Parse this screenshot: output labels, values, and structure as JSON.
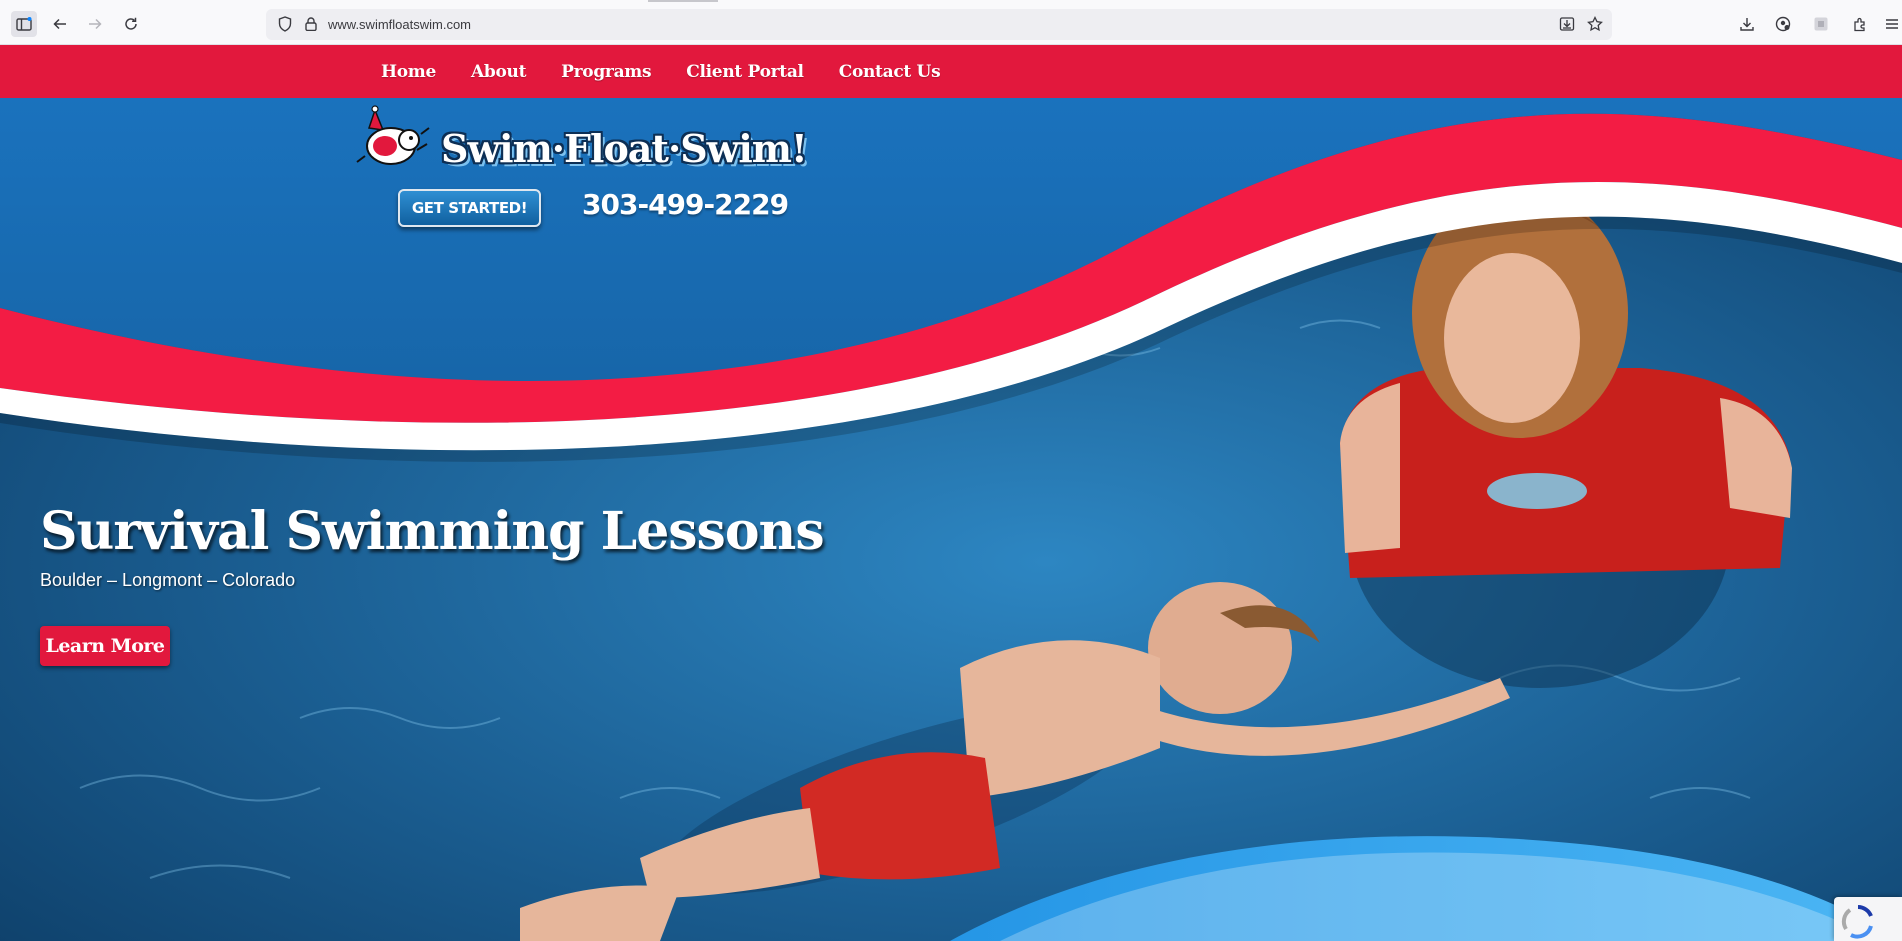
{
  "browser": {
    "url": "www.swimfloatswim.com",
    "icons": [
      "sidebar-icon",
      "back-icon",
      "forward-icon",
      "reload-icon",
      "shield-icon",
      "lock-icon",
      "save-page-icon",
      "star-icon",
      "downloads-icon",
      "account-icon",
      "extension-icon",
      "extensions-icon",
      "menu-icon"
    ]
  },
  "nav": {
    "items": [
      "Home",
      "About",
      "Programs",
      "Client Portal",
      "Contact Us"
    ]
  },
  "header": {
    "logo_text": "Swim·Float·Swim!",
    "cta_label": "GET STARTED!",
    "phone": "303-499-2229"
  },
  "hero": {
    "title": "Survival Swimming Lessons",
    "subtitle": "Boulder – Longmont – Colorado",
    "button_label": "Learn More"
  },
  "colors": {
    "brand_red": "#e2183d",
    "brand_blue": "#1a6fb8",
    "pool": "#1b5f93"
  }
}
